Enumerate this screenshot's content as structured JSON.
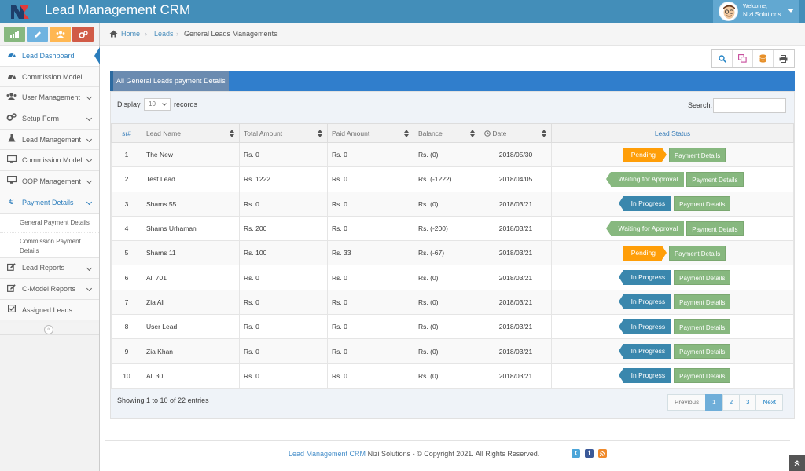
{
  "app": {
    "title": "Lead Management CRM",
    "accent": "#438eb9",
    "user": {
      "welcome": "Welcome,",
      "name": "Nizi Solutions"
    }
  },
  "sidebar": {
    "shortcuts": [
      {
        "icon": "signal-icon",
        "color": "#87b87f"
      },
      {
        "icon": "pencil-icon",
        "color": "#6fb3e0"
      },
      {
        "icon": "users-icon",
        "color": "#ffb752"
      },
      {
        "icon": "cogs-icon",
        "color": "#d15b47"
      }
    ],
    "items": [
      {
        "label": "Lead Dashboard",
        "icon": "tachometer-icon",
        "active": true
      },
      {
        "label": "Commission Model",
        "icon": "tachometer-icon"
      },
      {
        "label": "User Management",
        "icon": "users-icon",
        "chevron": true
      },
      {
        "label": "Setup Form",
        "icon": "cogs-icon",
        "chevron": true
      },
      {
        "label": "Lead Management",
        "icon": "flask-icon",
        "chevron": true
      },
      {
        "label": "Commission Model",
        "icon": "desktop-icon",
        "chevron": true
      },
      {
        "label": "OOP Management",
        "icon": "desktop-icon",
        "chevron": true
      },
      {
        "label": "Payment Details",
        "icon": "euro-icon",
        "chevron": true,
        "open": true
      },
      {
        "label": "Lead Reports",
        "icon": "edit-icon",
        "chevron": true
      },
      {
        "label": "C-Model Reports",
        "icon": "edit-icon",
        "chevron": true
      },
      {
        "label": "Assigned Leads",
        "icon": "check-square-icon"
      }
    ],
    "submenu": {
      "general": "General Payment Details",
      "commission_line1": "Commission Payment",
      "commission_line2": "Details"
    }
  },
  "breadcrumbs": {
    "home": "Home",
    "leads": "Leads",
    "current": "General Leads Managements"
  },
  "panel": {
    "title": "All General Leads payment Details",
    "display_label": "Display",
    "display_value": "10",
    "records_label": "records",
    "search_label": "Search:",
    "search_placeholder": ""
  },
  "table": {
    "headers": {
      "sr": "sr#",
      "lead_name": "Lead Name",
      "total_amount": "Total Amount",
      "paid_amount": "Paid Amount",
      "balance": "Balance",
      "date": "Date",
      "status": "Lead Status"
    },
    "pay_label": "Payment Details",
    "rows": [
      {
        "sr": "1",
        "name": "The New",
        "total": "Rs. 0",
        "paid": "Rs. 0",
        "balance": "Rs. (0)",
        "date": "2018/05/30",
        "status": "Pending"
      },
      {
        "sr": "2",
        "name": "Test Lead",
        "total": "Rs. 1222",
        "paid": "Rs. 0",
        "balance": "Rs. (-1222)",
        "date": "2018/04/05",
        "status": "Waiting for Approval"
      },
      {
        "sr": "3",
        "name": "Shams 55",
        "total": "Rs. 0",
        "paid": "Rs. 0",
        "balance": "Rs. (0)",
        "date": "2018/03/21",
        "status": "In Progress"
      },
      {
        "sr": "4",
        "name": "Shams Urhaman",
        "total": "Rs. 200",
        "paid": "Rs. 0",
        "balance": "Rs. (-200)",
        "date": "2018/03/21",
        "status": "Waiting for Approval"
      },
      {
        "sr": "5",
        "name": "Shams 11",
        "total": "Rs. 100",
        "paid": "Rs. 33",
        "balance": "Rs. (-67)",
        "date": "2018/03/21",
        "status": "Pending"
      },
      {
        "sr": "6",
        "name": "Ali 701",
        "total": "Rs. 0",
        "paid": "Rs. 0",
        "balance": "Rs. (0)",
        "date": "2018/03/21",
        "status": "In Progress"
      },
      {
        "sr": "7",
        "name": "Zia Ali",
        "total": "Rs. 0",
        "paid": "Rs. 0",
        "balance": "Rs. (0)",
        "date": "2018/03/21",
        "status": "In Progress"
      },
      {
        "sr": "8",
        "name": "User Lead",
        "total": "Rs. 0",
        "paid": "Rs. 0",
        "balance": "Rs. (0)",
        "date": "2018/03/21",
        "status": "In Progress"
      },
      {
        "sr": "9",
        "name": "Zia Khan",
        "total": "Rs. 0",
        "paid": "Rs. 0",
        "balance": "Rs. (0)",
        "date": "2018/03/21",
        "status": "In Progress"
      },
      {
        "sr": "10",
        "name": "Ali 30",
        "total": "Rs. 0",
        "paid": "Rs. 0",
        "balance": "Rs. (0)",
        "date": "2018/03/21",
        "status": "In Progress"
      }
    ],
    "status_colors": {
      "Pending": "#ff9e08",
      "Waiting for Approval": "#87b87f",
      "In Progress": "#3a87ad"
    }
  },
  "pagination": {
    "info": "Showing 1 to 10 of 22 entries",
    "previous": "Previous",
    "pages": [
      "1",
      "2",
      "3"
    ],
    "current": "1",
    "next": "Next"
  },
  "footer": {
    "brand": "Lead Management CRM",
    "text": " Nizi Solutions - © Copyright 2021. All Rights Reserved."
  }
}
